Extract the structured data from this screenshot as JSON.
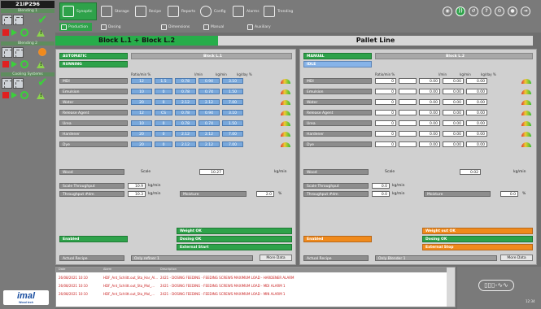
{
  "plant": {
    "id": "21IP296"
  },
  "left_strips": [
    "Blending 1",
    "Blending 2",
    "Cooling Systems"
  ],
  "topnav": {
    "items": [
      "Synoptic",
      "Storage",
      "Recipe",
      "Reports",
      "Config",
      "Alarms",
      "Trending"
    ],
    "sub": [
      "Production",
      "Dosing",
      "Dimensions",
      "Manual",
      "Auxiliary"
    ]
  },
  "title": {
    "left": "Block L.1 + Block L.2",
    "right": "Pallet Line"
  },
  "left": {
    "mode": "AUTOMATIC",
    "state": "RUNNING",
    "block": "Block L.1",
    "cols": [
      "Ratio/min %",
      "",
      "l/min",
      "kg/min",
      "kg/day %"
    ],
    "rows": [
      {
        "name": "MDI",
        "a": "12",
        "b": "1.5",
        "c": "0.78",
        "d": "0.94",
        "e": "3.10"
      },
      {
        "name": "Emulsion",
        "a": "10",
        "b": "0",
        "c": "0.78",
        "d": "0.74",
        "e": "1.50"
      },
      {
        "name": "Water",
        "a": "20",
        "b": "0",
        "c": "2.12",
        "d": "2.12",
        "e": "7.00"
      },
      {
        "name": "Release Agent",
        "a": "12",
        "b": "CS",
        "c": "0.78",
        "d": "0.94",
        "e": "3.10"
      },
      {
        "name": "Urea",
        "a": "10",
        "b": "0",
        "c": "0.78",
        "d": "0.74",
        "e": "1.50"
      },
      {
        "name": "Hardener",
        "a": "20",
        "b": "0",
        "c": "2.12",
        "d": "2.12",
        "e": "7.00"
      },
      {
        "name": "Dye",
        "a": "20",
        "b": "0",
        "c": "2.12",
        "d": "2.12",
        "e": "7.00"
      }
    ],
    "wood": {
      "label": "Wood",
      "scale": "Scale",
      "value": "10.27",
      "unit": "kg/min"
    },
    "scale_throughput": {
      "label": "Scale Throughput",
      "value": "10.9",
      "unit": "kg/min"
    },
    "throughput_dm": {
      "label": "Throughput #dm",
      "value": "10.3",
      "unit": "kg/min"
    },
    "moisture": {
      "label": "Moisture",
      "value": "2.0",
      "unit": "%"
    },
    "status": [
      "Weight OK",
      "Dosing OK",
      "External Start"
    ],
    "enabled": "Enabled",
    "recipe_label": "Actual Recipe",
    "recipe_value": "Only refiner 1",
    "more": "More Data"
  },
  "right": {
    "mode": "MANUAL",
    "state": "IDLE",
    "block": "Block L.2",
    "rows": [
      {
        "name": "MDI",
        "a": "0",
        "b": "",
        "c": "0.00",
        "d": "0.00",
        "e": "0.00"
      },
      {
        "name": "Emulsion",
        "a": "0",
        "b": "",
        "c": "0.00",
        "d": "0.00",
        "e": "0.00"
      },
      {
        "name": "Water",
        "a": "0",
        "b": "",
        "c": "0.00",
        "d": "0.00",
        "e": "0.00"
      },
      {
        "name": "Release Agent",
        "a": "0",
        "b": "",
        "c": "0.00",
        "d": "0.00",
        "e": "0.00"
      },
      {
        "name": "Urea",
        "a": "0",
        "b": "",
        "c": "0.00",
        "d": "0.00",
        "e": "0.00"
      },
      {
        "name": "Hardener",
        "a": "0",
        "b": "",
        "c": "0.00",
        "d": "0.00",
        "e": "0.00"
      },
      {
        "name": "Dye",
        "a": "0",
        "b": "",
        "c": "0.00",
        "d": "0.00",
        "e": "0.00"
      }
    ],
    "wood": {
      "label": "Wood",
      "scale": "Scale",
      "value": "0.02",
      "unit": "kg/min"
    },
    "scale_throughput": {
      "label": "Scale Throughput",
      "value": "0.0",
      "unit": "kg/min"
    },
    "throughput_dm": {
      "label": "Throughput #dm",
      "value": "0.0",
      "unit": "kg/min"
    },
    "moisture": {
      "label": "Moisture",
      "value": "0.0",
      "unit": "%"
    },
    "status": [
      "Weight out OK",
      "Dosing OK",
      "External Stop"
    ],
    "enabled": "Enabled",
    "recipe_label": "Actual Recipe",
    "recipe_value": "Only Blender 1",
    "more": "More Data"
  },
  "alarms": {
    "headers": [
      "Date",
      "Alarm",
      "Description"
    ],
    "rows": [
      {
        "date": "26/08/2021 10:10",
        "tag": "HDF_Ant_Schlitt.out_Sta_Har_Al...",
        "desc": "2421 - DOSING FEEDING - FEEDING SCREWS MAXIMUM LOAD - HARDENER ALARM"
      },
      {
        "date": "26/08/2021 10:10",
        "tag": "HDF_Ant_Schlitt.out_Sta_Mol_...",
        "desc": "2421 - DOSING FEEDING - FEEDING SCREWS MAXIMUM LOAD - MDI ALARM 1"
      },
      {
        "date": "26/08/2021 10:10",
        "tag": "HDF_Ant_Schlitt.out_Sta_Mol_...",
        "desc": "2421 - DOSING FEEDING - FEEDING SCREWS MAXIMUM LOAD - MIN ALARM 1"
      }
    ]
  },
  "logo": {
    "brand": "imal",
    "sub": "Wood tech"
  },
  "clock": "12:34"
}
